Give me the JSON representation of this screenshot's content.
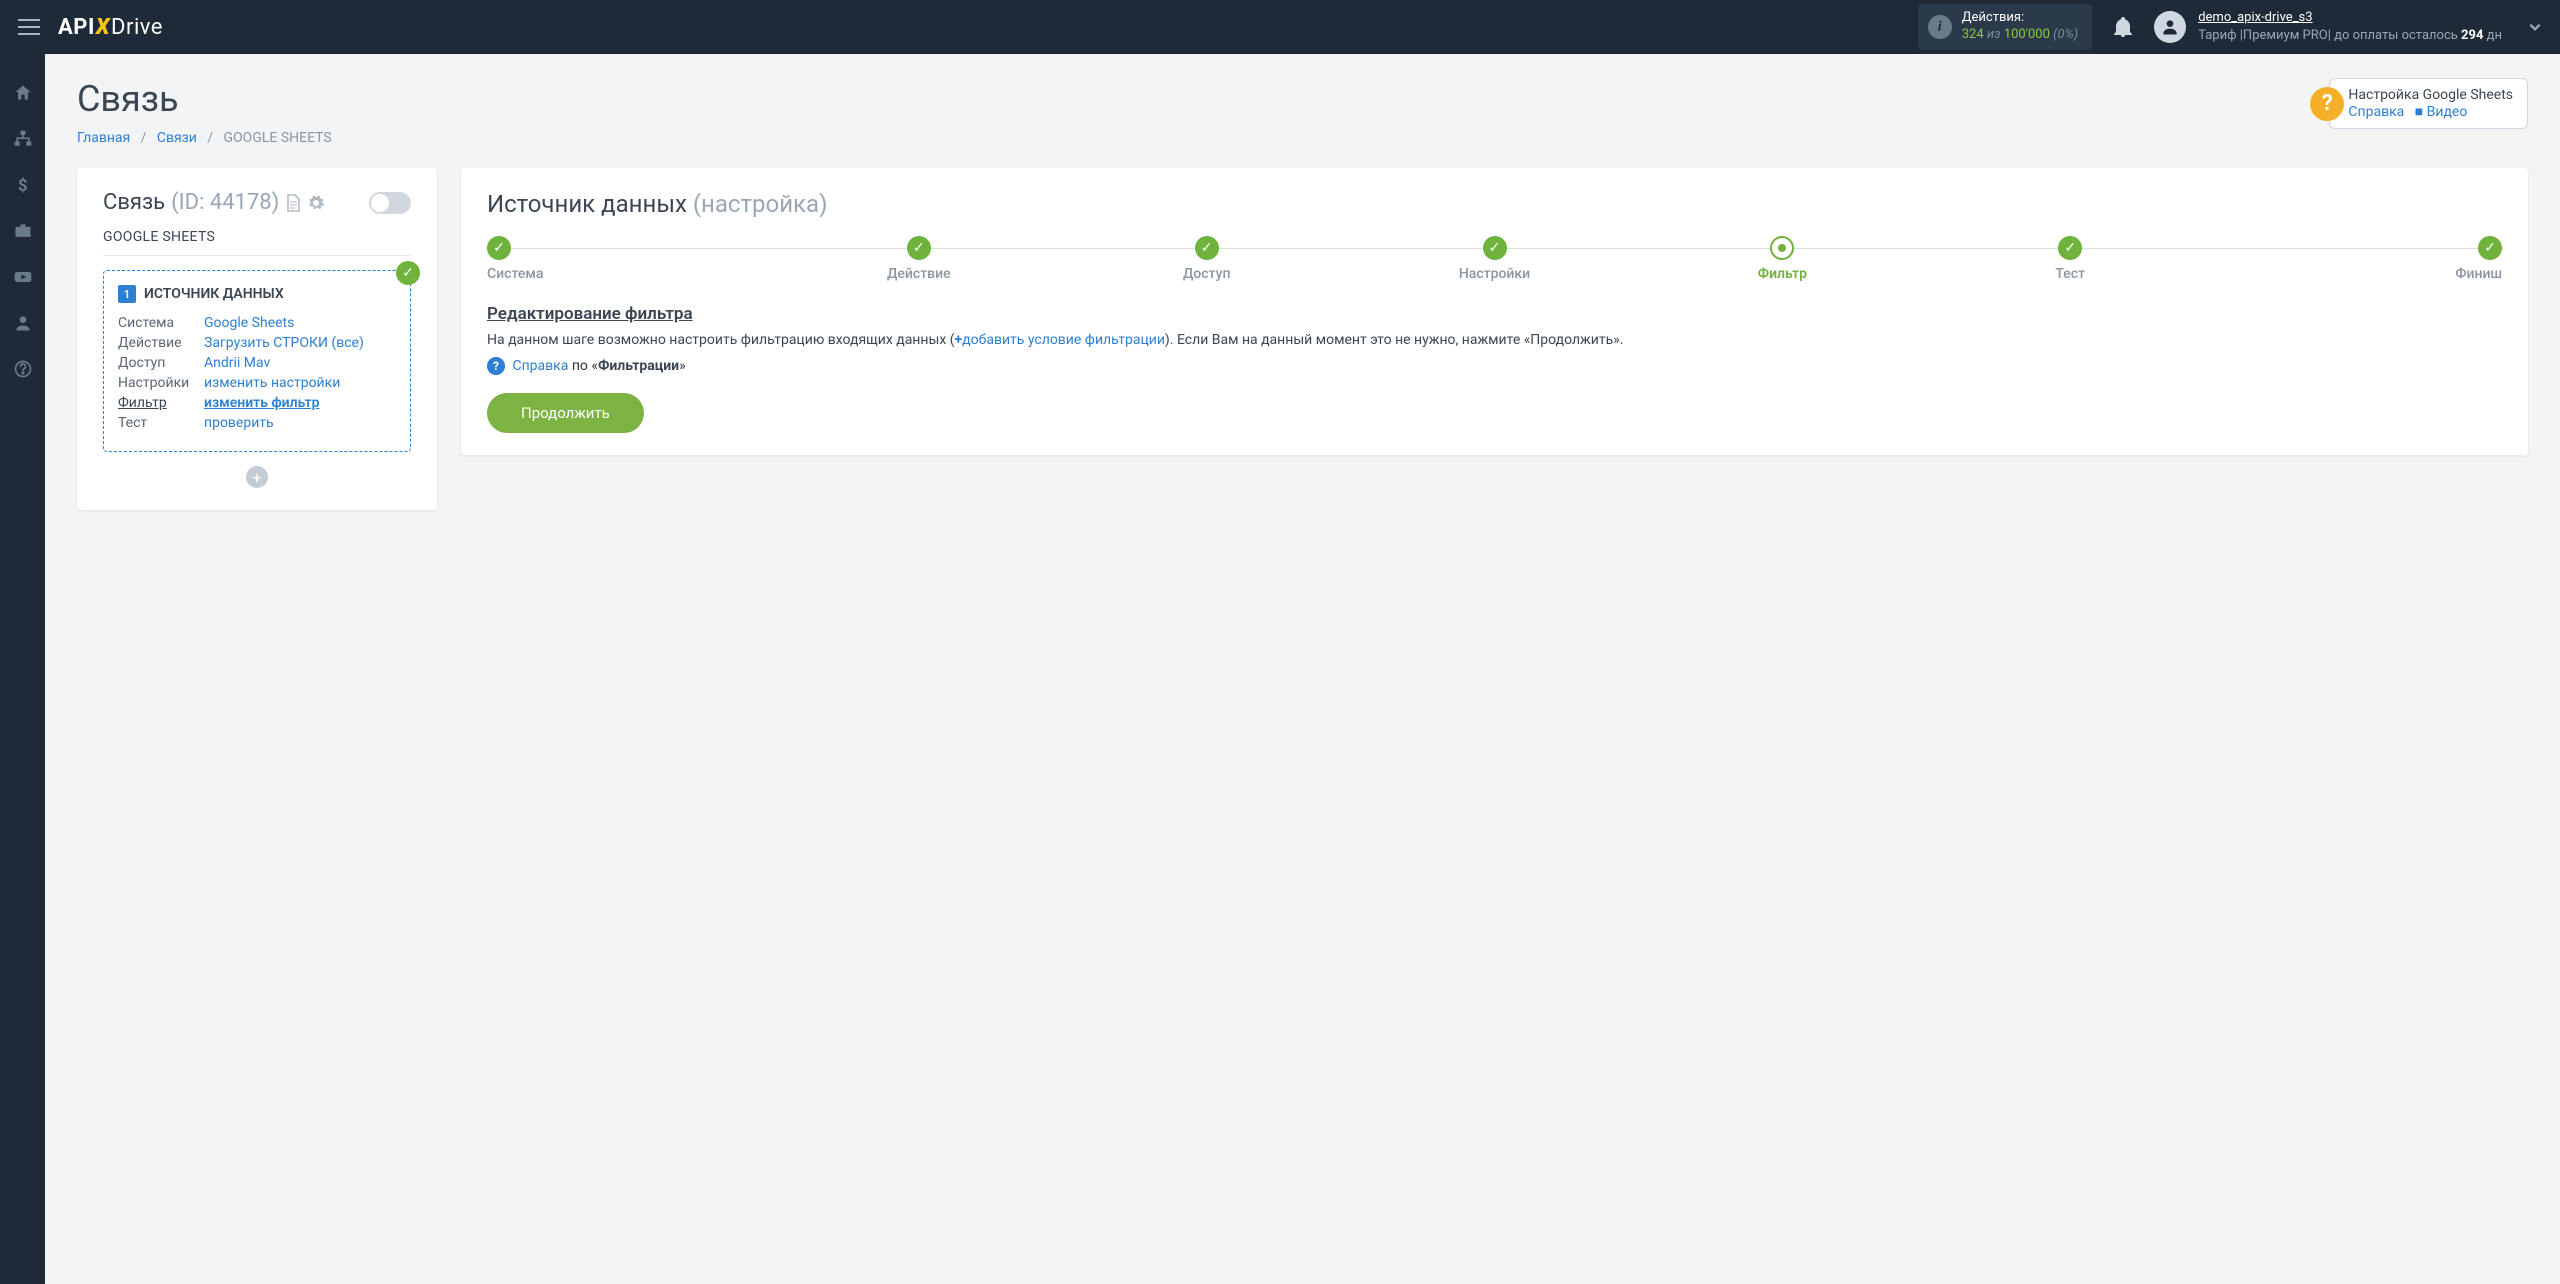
{
  "header": {
    "logo_a": "API",
    "logo_b": "Drive",
    "actions_label": "Действия:",
    "actions_used": "324",
    "actions_of": "из",
    "actions_total": "100'000",
    "actions_pct": "(0%)",
    "username": "demo_apix-drive_s3",
    "tariff_prefix": "Тариф |Премиум PRO| до оплаты осталось ",
    "tariff_days": "294",
    "tariff_suffix": " дн"
  },
  "page": {
    "title": "Связь",
    "crumbs": {
      "home": "Главная",
      "sep": "/",
      "links": "Связи",
      "current": "GOOGLE SHEETS"
    }
  },
  "help": {
    "title": "Настройка Google Sheets",
    "ref": "Справка",
    "video": "Видео"
  },
  "left": {
    "title": "Связь",
    "id": "(ID: 44178)",
    "system": "GOOGLE SHEETS",
    "source_heading": "ИСТОЧНИК ДАННЫХ",
    "rows": [
      {
        "k": "Система",
        "v": "Google Sheets"
      },
      {
        "k": "Действие",
        "v": "Загрузить СТРОКИ (все)"
      },
      {
        "k": "Доступ",
        "v": "Andrii Mav"
      },
      {
        "k": "Настройки",
        "v": "изменить настройки"
      },
      {
        "k": "Фильтр",
        "v": "изменить фильтр",
        "active": true
      },
      {
        "k": "Тест",
        "v": "проверить"
      }
    ]
  },
  "right": {
    "title_main": "Источник данных",
    "title_sub": "(настройка)",
    "steps": [
      "Система",
      "Действие",
      "Доступ",
      "Настройки",
      "Фильтр",
      "Тест",
      "Финиш"
    ],
    "current_step": 4,
    "section_title": "Редактирование фильтра",
    "desc_a": "На данном шаге возможно настроить фильтрацию входящих данных (",
    "desc_link": "добавить условие фильтрации",
    "desc_b": "). Если Вам на данный момент это не нужно, нажмите «Продолжить».",
    "help_ref": "Справка",
    "help_mid": " по «",
    "help_topic": "Фильтрации",
    "help_end": "»",
    "continue": "Продолжить"
  }
}
